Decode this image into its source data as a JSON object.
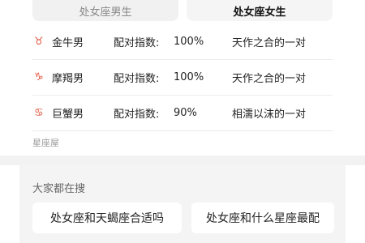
{
  "tabs": [
    {
      "label": "处女座男生",
      "active": false
    },
    {
      "label": "处女座女生",
      "active": true
    }
  ],
  "matches": [
    {
      "icon": "taurus-icon",
      "symbol": "♉",
      "name": "金牛男",
      "score_label": "配对指数:",
      "score": "100%",
      "desc": "天作之合的一对"
    },
    {
      "icon": "capricorn-icon",
      "symbol": "♑",
      "name": "摩羯男",
      "score_label": "配对指数:",
      "score": "100%",
      "desc": "天作之合的一对"
    },
    {
      "icon": "cancer-icon",
      "symbol": "♋",
      "name": "巨蟹男",
      "score_label": "配对指数:",
      "score": "90%",
      "desc": "相濡以沫的一对"
    }
  ],
  "source": "星座屋",
  "search": {
    "title": "大家都在搜",
    "chips": [
      "处女座和天蝎座合适吗",
      "处女座和什么星座最配"
    ]
  },
  "colors": {
    "accent": "#e0503a",
    "tab_inactive_text": "#888888",
    "card_bg": "#f4f4f4"
  }
}
